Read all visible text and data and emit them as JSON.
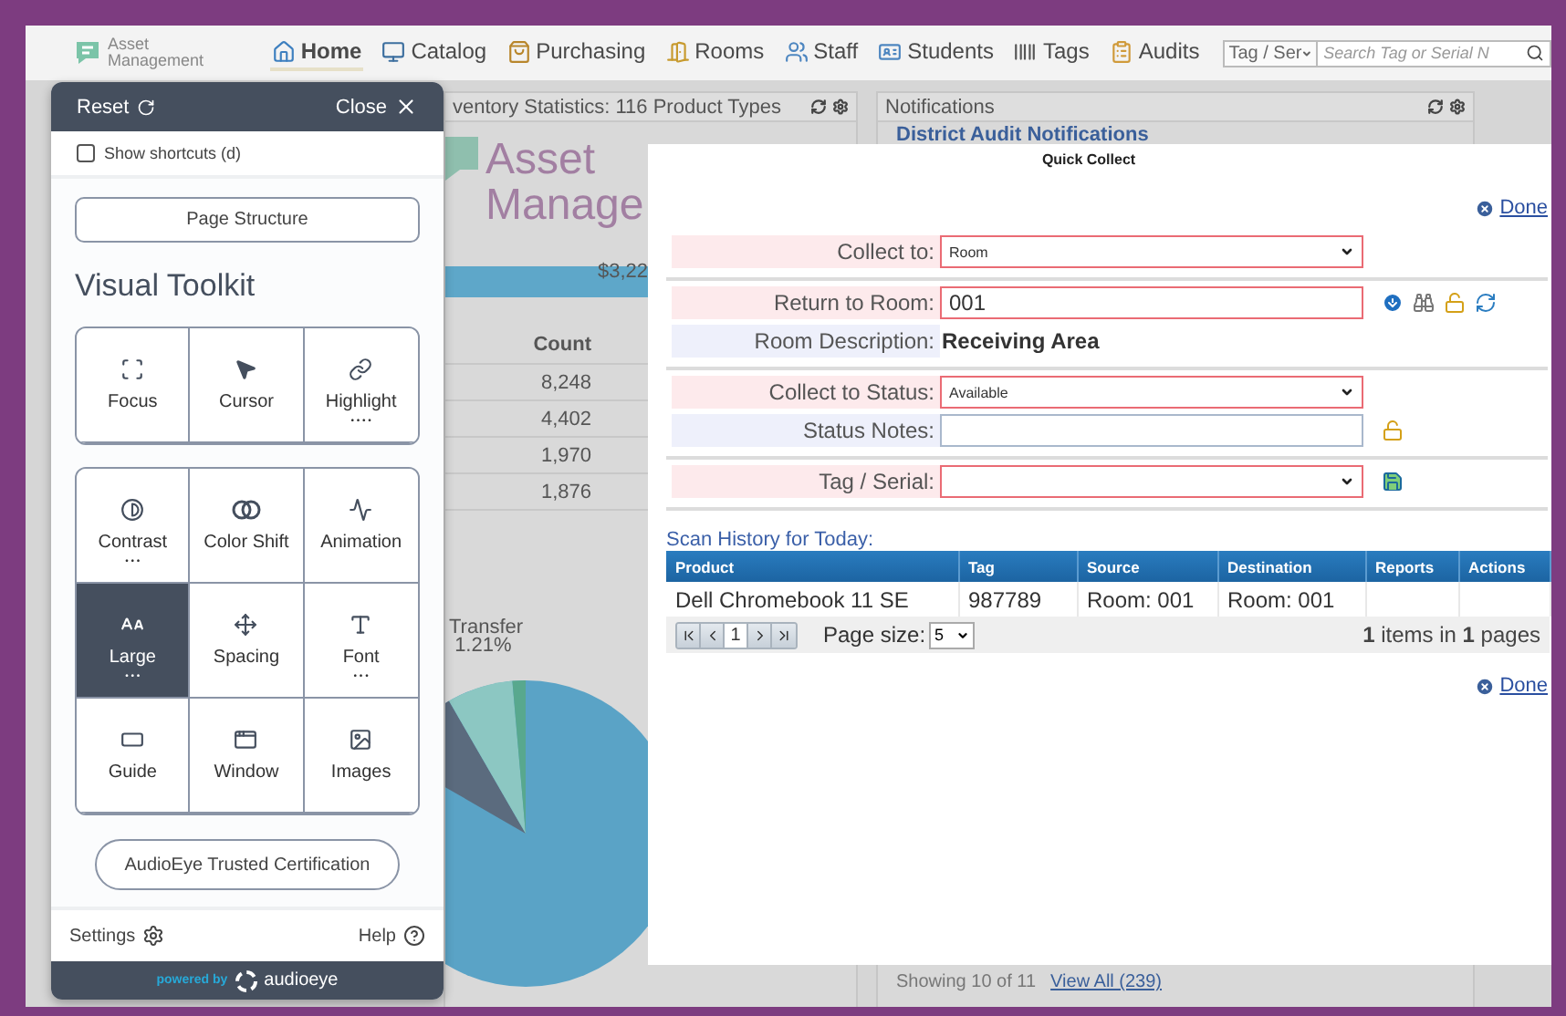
{
  "nav": {
    "logo_lines": [
      "Asset",
      "Management"
    ],
    "items": [
      {
        "label": "Home",
        "selected": true
      },
      {
        "label": "Catalog",
        "selected": false
      },
      {
        "label": "Purchasing",
        "selected": false
      },
      {
        "label": "Rooms",
        "selected": false
      },
      {
        "label": "Staff",
        "selected": false
      },
      {
        "label": "Students",
        "selected": false
      },
      {
        "label": "Tags",
        "selected": false
      },
      {
        "label": "Audits",
        "selected": false
      }
    ],
    "search": {
      "type_value": "Tag / Ser",
      "placeholder": "Search Tag or Serial N"
    }
  },
  "dashboard": {
    "stats": {
      "title": "ventory Statistics: 116 Product Types",
      "logo_lines": [
        "Asset",
        "Manage"
      ],
      "total": "$3,22",
      "count_header": "Count",
      "counts": [
        "8,248",
        "4,402",
        "1,970",
        "1,876"
      ],
      "pie_label": [
        "Transfer",
        "1.21%"
      ]
    },
    "notifications": {
      "title": "Notifications",
      "subtitle": "District Audit Notifications",
      "footer": "Showing 10 of 11",
      "footer_link": "View All (239)"
    }
  },
  "quick_collect": {
    "title": "Quick Collect",
    "done": "Done",
    "groups": [
      [
        {
          "kind": "select",
          "label": "Collect to:",
          "value": "Room",
          "required": true
        }
      ],
      [
        {
          "kind": "input",
          "label": "Return to Room:",
          "value": "001",
          "required": true
        },
        {
          "kind": "text",
          "label": "Room Description:",
          "value": "Receiving Area",
          "required": false
        }
      ],
      [
        {
          "kind": "select",
          "label": "Collect to Status:",
          "value": "Available",
          "required": true
        },
        {
          "kind": "input",
          "label": "Status Notes:",
          "required": false
        }
      ],
      [
        {
          "kind": "select",
          "label": "Tag / Serial:",
          "required": true
        }
      ]
    ],
    "history_title": "Scan History for Today:",
    "columns": [
      "Product",
      "Tag",
      "Source",
      "Destination",
      "Reports",
      "Actions"
    ],
    "rows": [
      [
        "Dell Chromebook 11 SE",
        "987789",
        "Room: 001",
        "Room: 001"
      ]
    ],
    "pager": {
      "page": "1",
      "size_label": "Page size:",
      "size": "5",
      "summary": "**1** items in **1** pages"
    },
    "done_bottom": "Done"
  },
  "toolkit": {
    "reset": "Reset",
    "close": "Close",
    "show_shortcuts": {
      "label": "Show shortcuts (d)",
      "checked": false
    },
    "page_structure": "Page Structure",
    "heading": "Visual Toolkit",
    "groups": [
      [
        {
          "label": "Focus",
          "selected": false
        },
        {
          "label": "Cursor",
          "selected": false
        },
        {
          "label": "Highlight",
          "selected": false,
          "dots": "• • • •"
        }
      ],
      [
        {
          "label": "Contrast",
          "selected": false,
          "dots": "• • •"
        },
        {
          "label": "Color Shift",
          "selected": false
        },
        {
          "label": "Animation",
          "selected": false
        },
        {
          "label": "Large",
          "selected": true,
          "dots": "• • •"
        },
        {
          "label": "Spacing",
          "selected": false
        },
        {
          "label": "Font",
          "selected": false,
          "dots": "• • •"
        },
        {
          "label": "Guide",
          "selected": false
        },
        {
          "label": "Window",
          "selected": false
        },
        {
          "label": "Images",
          "selected": false
        }
      ]
    ],
    "certification": "AudioEye Trusted Certification",
    "settings": "Settings",
    "help": "Help",
    "powered_by": "powered by",
    "brand": "audioeye"
  }
}
